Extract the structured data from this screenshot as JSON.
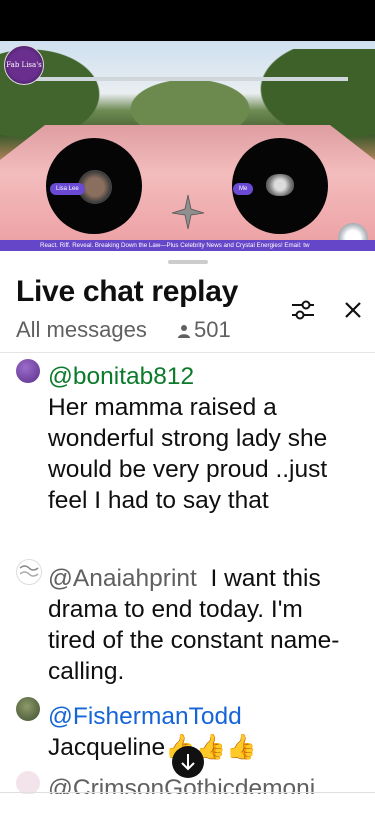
{
  "video": {
    "logo_text": "Fab Lisa's",
    "participant_left": "Lisa Lee",
    "participant_right": "Me",
    "ticker": "React. Riff. Reveal. Breaking Down the Law—Plus Celebrity News and Crystal Energies! Email: tw"
  },
  "chat": {
    "title": "Live chat replay",
    "filter": "All messages",
    "viewer_count": "501",
    "messages": [
      {
        "author": "@bonitab812",
        "text": "Her mamma raised a wonderful strong lady she would be very proud ..just feel I had to say that"
      },
      {
        "author": "@Anaiahprint",
        "text": "I want this drama to end today. I'm tired of the constant name-calling."
      },
      {
        "author": "@FishermanTodd",
        "text": "Jacqueline👍👍👍"
      },
      {
        "author": "@CrimsonGothicdemoni",
        "text": ""
      }
    ]
  },
  "icons": {
    "filter": "sliders-icon",
    "close": "close-icon",
    "viewers": "person-icon",
    "scroll": "arrow-down-icon"
  }
}
